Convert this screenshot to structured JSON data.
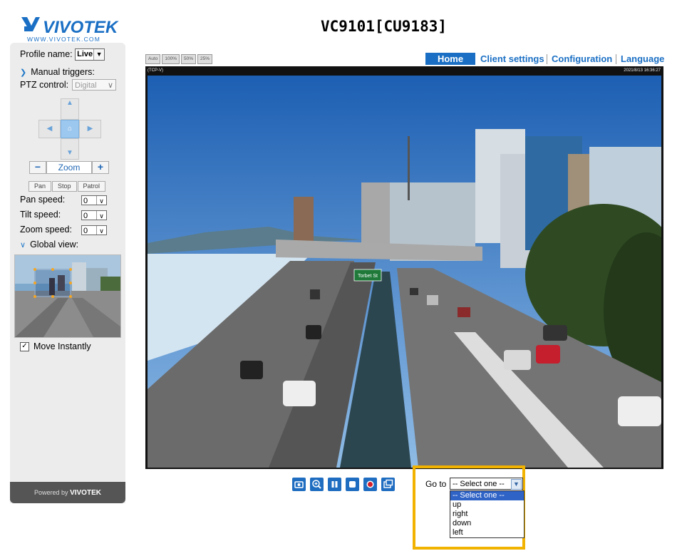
{
  "header": {
    "title": "VC9101[CU9183]"
  },
  "brand": {
    "logo_text": "VIVOTEK",
    "logo_url_text": "WWW.VIVOTEK.COM",
    "powered_by": "Powered by",
    "colors": {
      "accent": "#1a6fc4",
      "highlight": "#f2b200"
    }
  },
  "sidebar": {
    "profile_label": "Profile name:",
    "profile_value": "Live",
    "manual_triggers": "Manual triggers:",
    "ptz_label": "PTZ control:",
    "ptz_value": "Digital",
    "zoom_label": "Zoom",
    "zoom_minus": "−",
    "zoom_plus": "+",
    "pan_btn": "Pan",
    "stop_btn": "Stop",
    "patrol_btn": "Patrol",
    "pan_speed_label": "Pan speed:",
    "pan_speed_value": "0",
    "tilt_speed_label": "Tilt speed:",
    "tilt_speed_value": "0",
    "zoom_speed_label": "Zoom speed:",
    "zoom_speed_value": "0",
    "global_view_label": "Global view:",
    "move_instantly_label": "Move Instantly",
    "move_instantly_checked": true
  },
  "view_size_buttons": [
    "Auto",
    "100%",
    "50%",
    "25%"
  ],
  "nav": {
    "home": "Home",
    "client_settings": "Client settings",
    "configuration": "Configuration",
    "language": "Language"
  },
  "camera": {
    "stream_label": "(TCP-V)",
    "timestamp": "2021/8/13 16:36:27",
    "sign_text": "Torbet St"
  },
  "goto": {
    "label": "Go to",
    "selected": "-- Select one --",
    "options": [
      "-- Select one --",
      "up",
      "right",
      "down",
      "left"
    ]
  },
  "controls": [
    "snapshot-icon",
    "digital-zoom-icon",
    "pause-icon",
    "stop-icon",
    "record-icon",
    "fullscreen-icon"
  ]
}
